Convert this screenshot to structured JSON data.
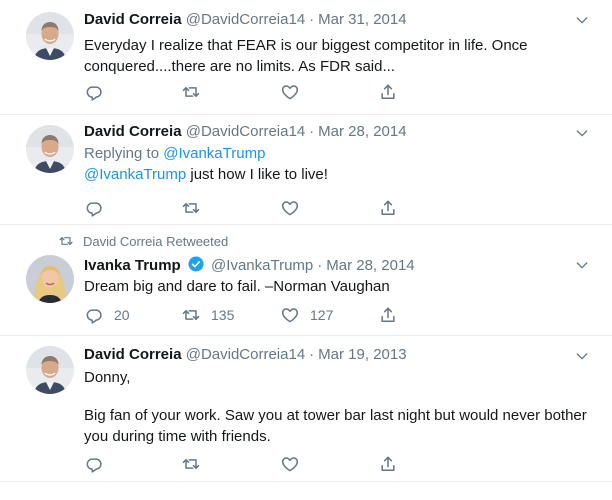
{
  "tweets": [
    {
      "name": "David Correia",
      "handle": "@DavidCorreia14",
      "date": "Mar 31, 2014",
      "text_line1": "Everyday I realize that FEAR is our biggest competitor in life. Once",
      "text_line2": "conquered....there are no limits. As FDR said...",
      "reply_count": "",
      "retweet_count": "",
      "like_count": ""
    },
    {
      "name": "David Correia",
      "handle": "@DavidCorreia14",
      "date": "Mar 28, 2014",
      "replying_prefix": "Replying to",
      "replying_to": "@IvankaTrump",
      "mention": "@IvankaTrump",
      "text_after_mention": " just how I like to live!",
      "reply_count": "",
      "retweet_count": "",
      "like_count": ""
    },
    {
      "retweet_label": "David Correia Retweeted",
      "name": "Ivanka Trump",
      "handle": "@IvankaTrump",
      "date": "Mar 28, 2014",
      "text": "Dream big and dare to fail. –Norman Vaughan",
      "reply_count": "20",
      "retweet_count": "135",
      "like_count": "127"
    },
    {
      "name": "David Correia",
      "handle": "@DavidCorreia14",
      "date": "Mar 19, 2013",
      "text_line1": "Donny,",
      "text_line2": "Big fan of your work. Saw you at tower bar last night but would never bother",
      "text_line3": "you during time with friends.",
      "reply_count": "",
      "retweet_count": "",
      "like_count": ""
    }
  ],
  "separator": "·",
  "colors": {
    "link": "#1b95e0",
    "muted": "#657786",
    "text": "#14171a",
    "border": "#e6ecf0",
    "verified": "#1da1f2"
  },
  "icons": [
    "reply-icon",
    "retweet-icon",
    "like-icon",
    "share-icon",
    "chevron-down-icon",
    "verified-badge-icon"
  ]
}
